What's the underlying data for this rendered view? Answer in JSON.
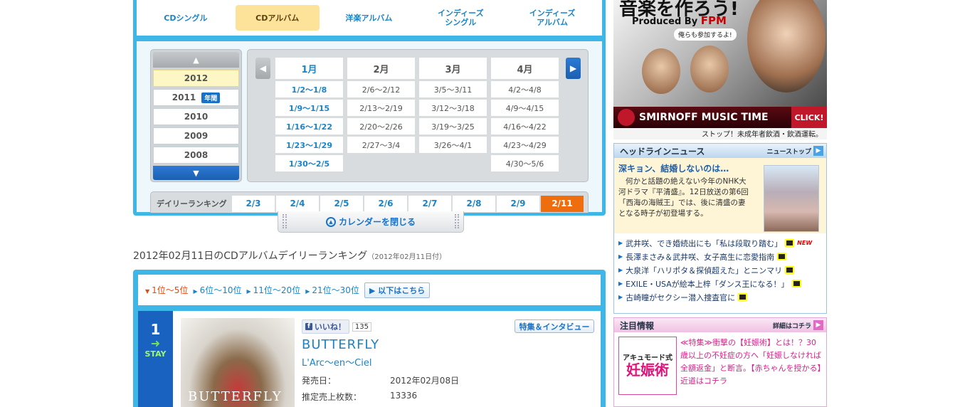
{
  "category_tabs": [
    {
      "label": "CDシングル"
    },
    {
      "label": "CDアルバム"
    },
    {
      "label": "洋楽アルバム"
    },
    {
      "label": "インディーズ\nシングル"
    },
    {
      "label": "インディーズ\nアルバム"
    }
  ],
  "years": {
    "up_icon": "arrow-up-icon",
    "down_icon": "arrow-down-icon",
    "items": [
      {
        "label": "2012"
      },
      {
        "label": "2011",
        "badge": "年間"
      },
      {
        "label": "2010"
      },
      {
        "label": "2009"
      },
      {
        "label": "2008"
      }
    ]
  },
  "months": [
    {
      "label": "1月",
      "weeks": [
        "1/2〜1/8",
        "1/9〜1/15",
        "1/16〜1/22",
        "1/23〜1/29",
        "1/30〜2/5"
      ]
    },
    {
      "label": "2月",
      "weeks": [
        "2/6〜2/12",
        "2/13〜2/19",
        "2/20〜2/26",
        "2/27〜3/4"
      ]
    },
    {
      "label": "3月",
      "weeks": [
        "3/5〜3/11",
        "3/12〜3/18",
        "3/19〜3/25",
        "3/26〜4/1"
      ]
    },
    {
      "label": "4月",
      "weeks": [
        "4/2〜4/8",
        "4/9〜4/15",
        "4/16〜4/22",
        "4/23〜4/29",
        "4/30〜5/6"
      ]
    }
  ],
  "daily": {
    "label": "デイリーランキング",
    "days": [
      "2/3",
      "2/4",
      "2/5",
      "2/6",
      "2/7",
      "2/8",
      "2/9",
      "2/11"
    ]
  },
  "close_calendar": "カレンダーを閉じる",
  "ranking_title": "2012年02月11日のCDアルバムデイリーランキング",
  "ranking_date_note": "（2012年02月11日付）",
  "range_nav": [
    "1位〜5位",
    "6位〜10位",
    "11位〜20位",
    "21位〜30位"
  ],
  "below_button": "以下はこちら",
  "rank_item": {
    "rank": "1",
    "movement": "STAY",
    "jacket_text": "BUTTERFLY",
    "like_label": "いいね！",
    "like_count": "135",
    "feature_label": "特集＆インタビュー",
    "title": "BUTTERFLY",
    "artist": "L'Arc〜en〜Ciel",
    "release_label": "発売日：",
    "release_date": "2012年02月08日",
    "sales_label": "推定売上枚数：",
    "sales": "13336"
  },
  "ad": {
    "headline": "音楽を作ろう!",
    "produced_by": "Produced By",
    "fpm": "FPM",
    "bubble": "俺らも参加するよ!",
    "brand": "SMIRNOFF MUSIC TIME",
    "click": "CLICK!",
    "warning": "ストップ！未成年者飲酒・飲酒運転。"
  },
  "headline_news": {
    "title": "ヘッドラインニュース",
    "link": "ニューストップ",
    "top_title": "深キョン、結婚しないのは…",
    "top_text": "何かと話題の絶えない今年のNHK大河ドラマ『平清盛』。12日放送の第6回「西海の海賊王」では、後に清盛の妻となる時子が初登場する。",
    "items": [
      {
        "text": "武井咲、でき婚続出にも「私は段取り踏む」",
        "new": "NEW"
      },
      {
        "text": "長澤まさみ＆武井咲、女子高生に恋愛指南"
      },
      {
        "text": "大泉洋「ハリポタ＆探偵超えた」とニンマリ"
      },
      {
        "text": "EXILE・USAが絵本上梓「ダンス王になる！」"
      },
      {
        "text": "古崎瞳がセクシー潜入捜査官に"
      }
    ]
  },
  "notice": {
    "title": "注目情報",
    "link": "詳細はコチラ",
    "img_top": "アキュモード式",
    "img_main": "妊娠術",
    "text": "≪特集≫衝撃の【妊娠術】とは！？30歳以上の不妊症の方へ「妊娠しなければ全額返金」と断言。【赤ちゃんを授かる】近道はコチラ"
  }
}
